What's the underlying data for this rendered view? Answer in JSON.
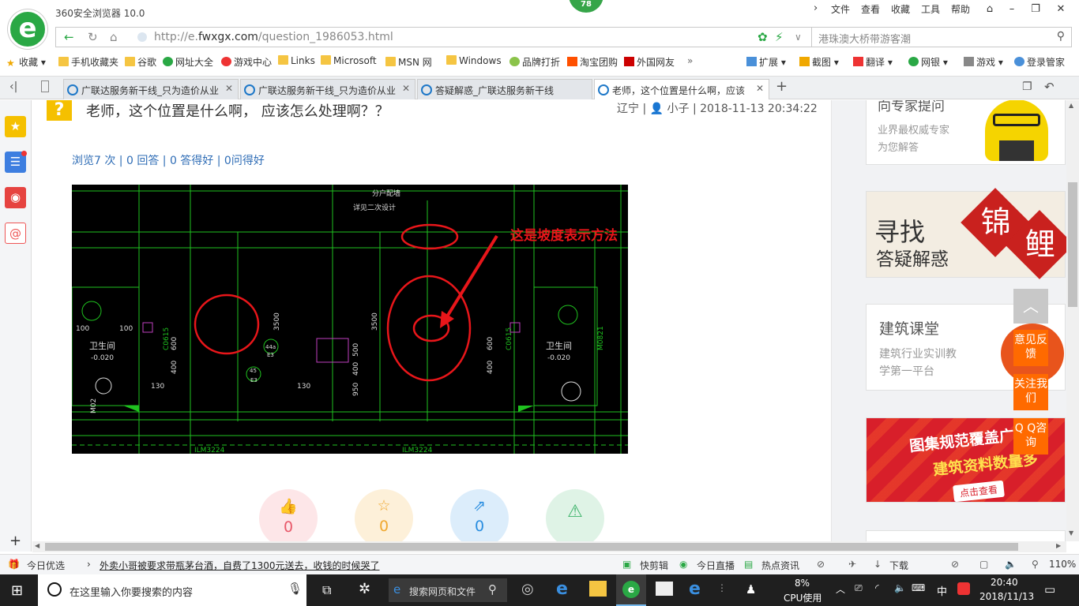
{
  "browser": {
    "title": "360安全浏览器 10.0",
    "badge": "78",
    "menu": [
      "文件",
      "查看",
      "收藏",
      "工具",
      "帮助"
    ],
    "url_prefix": "http://e.",
    "url_domain": "fwxgx.com",
    "url_path": "/question_1986053.html",
    "search_value": "港珠澳大桥带游客潮"
  },
  "bookmarks": [
    "收藏",
    "手机收藏夹",
    "谷歌",
    "网址大全",
    "游戏中心",
    "Links",
    "Microsoft",
    "MSN 网",
    "Windows",
    "品牌打折",
    "淘宝团购",
    "外国网友"
  ],
  "toolbar_right": [
    "扩展",
    "截图",
    "翻译",
    "网银",
    "游戏",
    "登录管家"
  ],
  "tabs": [
    {
      "label": "广联达服务新干线_只为造价从业"
    },
    {
      "label": "广联达服务新干线_只为造价从业"
    },
    {
      "label": "答疑解惑_广联达服务新干线"
    },
    {
      "label": "老师，这个位置是什么啊，应该"
    }
  ],
  "question": {
    "icon": "?",
    "title": "老师，这个位置是什么啊， 应该怎么处理啊？？",
    "meta": "辽宁 | 👤 小子 | 2018-11-13 20:34:22",
    "stats": "浏览7 次 | 0 回答 | 0 答得好 | 0问得好"
  },
  "cad": {
    "annotation": "这是坡度表示方法",
    "labels": [
      "分户配墙",
      "详见二次设计",
      "卫生间",
      "-0.020",
      "卫生间",
      "-0.020",
      "3500",
      "3500",
      "100",
      "100",
      "130",
      "130",
      "600",
      "400",
      "500",
      "400",
      "950",
      "600",
      "400",
      "C0615",
      "C0615",
      "M0821",
      "44a",
      "45",
      "E3",
      "E3",
      "ILM3224",
      "ILM3224",
      "M02"
    ]
  },
  "actions": [
    {
      "icon": "thumbs-up-icon",
      "count": "0",
      "color": "#e8596a"
    },
    {
      "icon": "star-icon",
      "count": "0",
      "color": "#f0a830"
    },
    {
      "icon": "share-icon",
      "count": "0",
      "color": "#2a8ee0"
    },
    {
      "icon": "warning-icon",
      "count": "",
      "color": "#3db36a"
    }
  ],
  "sidebar_right": {
    "expert_title": "向专家提问",
    "expert_sub1": "业界最权威专家",
    "expert_sub2": "为您解答",
    "find_title": "寻找",
    "find_sub": "答疑解惑",
    "find_seal1": "锦",
    "find_seal2": "鲤",
    "course_title": "建筑课堂",
    "course_sub1": "建筑行业实训教",
    "course_sub2": "学第一平台",
    "banner1": "图集规范覆盖广",
    "banner2": "建筑资料数量多",
    "banner_btn": "点击查看"
  },
  "float_buttons": [
    "意见反馈",
    "关注我们",
    "Q Q咨询"
  ],
  "statusbar": {
    "today": "今日优选",
    "news": "外卖小哥被要求带瓶茅台酒，自费了1300元送去，收钱的时候哭了",
    "items": [
      "快剪辑",
      "今日直播",
      "热点资讯",
      "下载"
    ],
    "zoom": "110%"
  },
  "taskbar": {
    "cortana": "在这里输入你要搜索的内容",
    "search_web": "搜索网页和文件",
    "cpu": "8%",
    "cpu_label": "CPU使用",
    "ime": "中",
    "time": "20:40",
    "date": "2018/11/13"
  }
}
